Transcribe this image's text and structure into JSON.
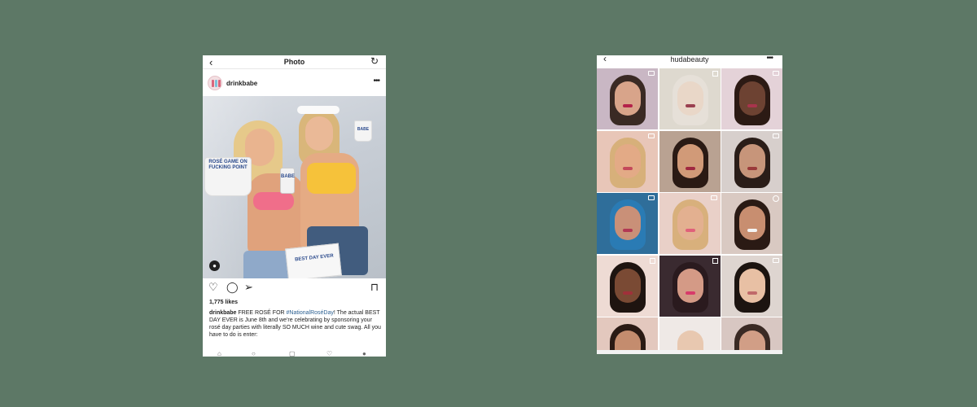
{
  "left": {
    "nav": {
      "back_icon": "‹",
      "title": "Photo",
      "refresh_icon": "↻"
    },
    "post": {
      "username": "drinkbabe",
      "more_icon": "•••",
      "photo_text": {
        "cup": "ROSÉ GAME ON FUCKING POINT",
        "can": "BABE",
        "cup2": "BABE",
        "box": "BEST DAY EVER"
      },
      "likes": "1,775 likes",
      "caption": {
        "user": "drinkbabe",
        "before": " FREE ROSÉ FOR ",
        "hashtag": "#NationalRoséDay",
        "after": "! The actual BEST DAY EVER is June 8th and we're celebrating by sponsoring your rosé day parties with literally SO MUCH wine and cute swag. All you have to do is enter:"
      }
    },
    "icons": {
      "like": "♡",
      "comment": "◯",
      "share": "➢",
      "bookmark": "⊓",
      "user_tag": "●"
    }
  },
  "right": {
    "nav": {
      "back_icon": "‹",
      "title": "hudabeauty",
      "more_icon": "•••"
    },
    "tiles": [
      {
        "bg": "#c9b7c4",
        "skin": "#d8a48a",
        "hair": "#3a2a24",
        "lips": "#b4224a",
        "icon": "video"
      },
      {
        "bg": "#ded9cf",
        "skin": "#e9d7c8",
        "hair": "#e6e0d8",
        "lips": "#9a4050",
        "icon": "multi"
      },
      {
        "bg": "#e4d2d8",
        "skin": "#6d4232",
        "hair": "#2c1a14",
        "lips": "#a8344c",
        "icon": "video"
      },
      {
        "bg": "#e8c6b8",
        "skin": "#e3aa86",
        "hair": "#d7b07a",
        "lips": "#c4495a",
        "icon": "video"
      },
      {
        "bg": "#b9a292",
        "skin": "#d19a78",
        "hair": "#2a1a14",
        "lips": "#a02840",
        "icon": "none"
      },
      {
        "bg": "#d7cfcc",
        "skin": "#c7957a",
        "hair": "#2a1d18",
        "lips": "#9a3a3a",
        "icon": "video"
      },
      {
        "bg": "#2f6e9a",
        "skin": "#c99078",
        "hair": "#2a7bb4",
        "lips": "#b23854",
        "icon": "video"
      },
      {
        "bg": "#e9d0c8",
        "skin": "#e3b090",
        "hair": "#d8b07c",
        "lips": "#e0607a",
        "icon": "video"
      },
      {
        "bg": "#d9c9c2",
        "skin": "#c88e70",
        "hair": "#2a1a14",
        "lips": "#f4f4f4",
        "icon": "more"
      },
      {
        "bg": "#eedbd4",
        "skin": "#7a4a34",
        "hair": "#1e1410",
        "lips": "#a0303a",
        "icon": "multi"
      },
      {
        "bg": "#3a2a30",
        "skin": "#d49a86",
        "hair": "#2a1a1e",
        "lips": "#d83a6a",
        "icon": "multi"
      },
      {
        "bg": "#ded5d0",
        "skin": "#e8c0a4",
        "hair": "#1c1410",
        "lips": "#c06a6a",
        "icon": "video"
      },
      {
        "bg": "#e3c8be",
        "skin": "#c48c6e",
        "hair": "#2a1a14",
        "lips": "#9c3a44",
        "icon": "none"
      },
      {
        "bg": "#efe9e6",
        "skin": "#e8c8b0",
        "hair": "#efe9e6",
        "lips": "#b06a6a",
        "icon": "none"
      },
      {
        "bg": "#d8c7c2",
        "skin": "#d19e86",
        "hair": "#3a2a24",
        "lips": "#9a3a4a",
        "icon": "none"
      }
    ]
  }
}
